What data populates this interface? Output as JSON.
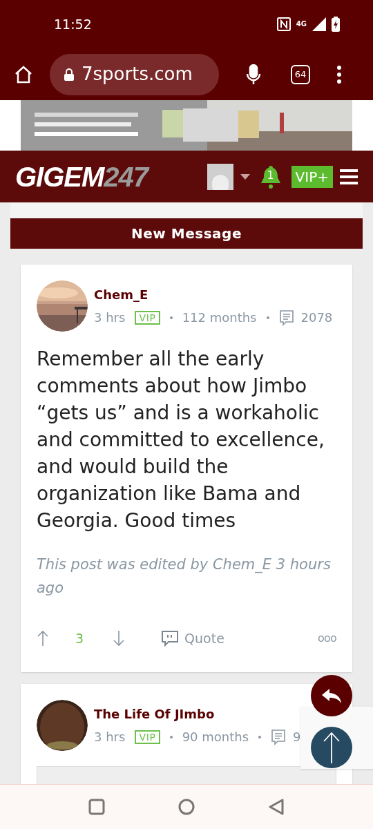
{
  "status_bar": {
    "time": "11:52",
    "network": "4G"
  },
  "browser": {
    "url": "7sports.com",
    "tab_count": "64"
  },
  "site_header": {
    "logo_main": "GIGEM",
    "logo_number": "247",
    "notification_count": "1",
    "vip_label": "VIP+"
  },
  "section_title": "New Message",
  "posts": [
    {
      "author": "Chem_E",
      "time": "3 hrs",
      "badge": "VIP",
      "tenure": "112 months",
      "post_count": "2078",
      "body": "Remember all the early comments about how Jimbo “gets us” and is a workaholic and committed to excellence, and would build the organization like Bama and Georgia. Good times",
      "edit_note": "This post was edited by Chem_E 3 hours ago",
      "score": "3",
      "quote_label": "Quote",
      "more": "ooo"
    },
    {
      "author": "The Life Of JImbo",
      "time": "3 hrs",
      "badge": "VIP",
      "tenure": "90 months",
      "post_count": "9"
    }
  ]
}
